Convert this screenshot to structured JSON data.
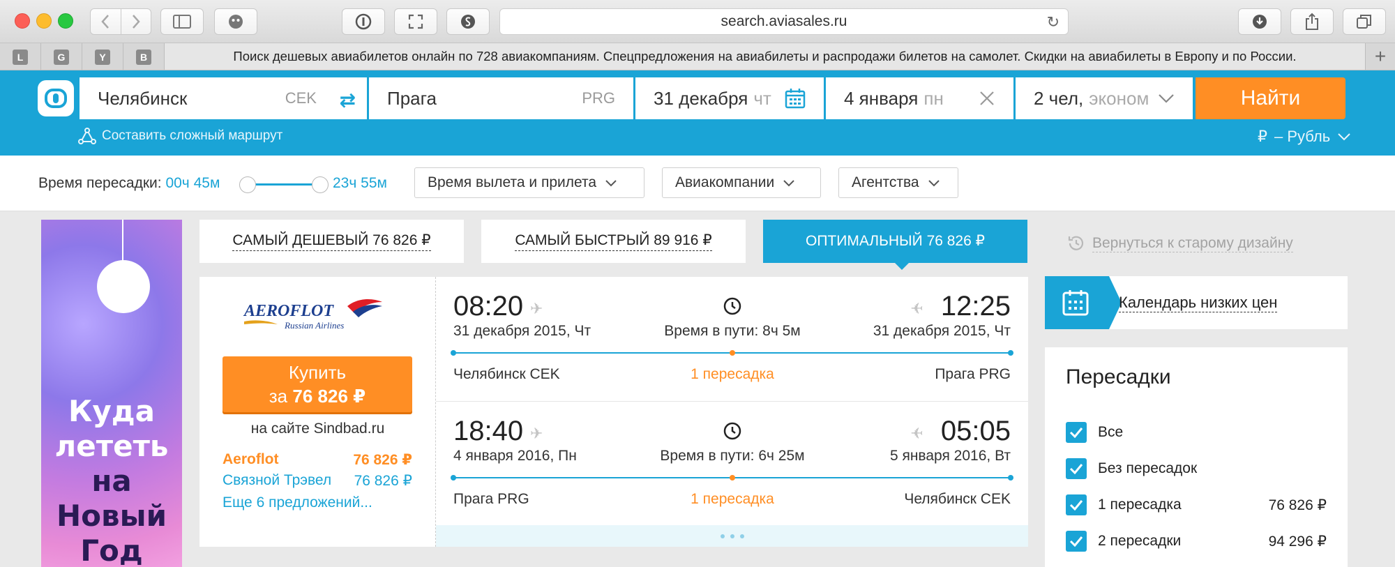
{
  "browser": {
    "url": "search.aviasales.ru",
    "bookmark_tabs": [
      "L",
      "G",
      "Y",
      "B"
    ],
    "tab_title": "Поиск дешевых авиабилетов онлайн по 728 авиакомпаниям. Спецпредложения на авиабилеты и распродажи билетов на самолет. Скидки на авиабилеты в Европу и по России."
  },
  "search": {
    "origin_city": "Челябинск",
    "origin_code": "CEK",
    "destination_city": "Прага",
    "destination_code": "PRG",
    "depart_date": "31 декабря",
    "depart_weekday": "чт",
    "return_date": "4 января",
    "return_weekday": "пн",
    "passengers": "2 чел,",
    "cabin_class": "эконом",
    "find_label": "Найти",
    "complex_route": "Составить сложный маршрут",
    "currency_symbol": "₽",
    "currency_label": "– Рубль"
  },
  "filters": {
    "transfer_time_label": "Время пересадки:",
    "transfer_min": "00ч 45м",
    "transfer_max": "23ч 55м",
    "dropdowns": [
      "Время вылета и прилета",
      "Авиакомпании",
      "Агентства"
    ]
  },
  "banner": {
    "line1": "Куда",
    "line2": "лететь",
    "line3": "на",
    "line4": "Новый",
    "line5": "Год"
  },
  "sort_tabs": [
    {
      "label": "Самый дешевый",
      "price": "76 826 ₽"
    },
    {
      "label": "Самый быстрый",
      "price": "89 916 ₽"
    },
    {
      "label": "Оптимальный",
      "price": "76 826 ₽"
    }
  ],
  "old_design_link": "Вернуться к старому дизайну",
  "result": {
    "airline_logo_name": "AEROFLOT",
    "airline_logo_sub": "Russian Airlines",
    "buy_line1": "Купить",
    "buy_prefix": "за",
    "buy_price": "76 826 ₽",
    "on_site": "на сайте Sindbad.ru",
    "offers": [
      {
        "name": "Aeroflot",
        "price": "76 826 ₽"
      },
      {
        "name": "Связной Трэвел",
        "price": "76 826 ₽"
      }
    ],
    "more_offers": "Еще 6 предложений...",
    "legs": [
      {
        "depart_time": "08:20",
        "depart_date": "31 декабря 2015, Чт",
        "duration": "Время в пути: 8ч 5м",
        "arrive_time": "12:25",
        "arrive_date": "31 декабря 2015, Чт",
        "from": "Челябинск CEK",
        "transfers": "1 пересадка",
        "to": "Прага PRG"
      },
      {
        "depart_time": "18:40",
        "depart_date": "4 января 2016, Пн",
        "duration": "Время в пути: 6ч 25м",
        "arrive_time": "05:05",
        "arrive_date": "5 января 2016, Вт",
        "from": "Прага PRG",
        "transfers": "1 пересадка",
        "to": "Челябинск CEK"
      }
    ]
  },
  "calendar_link": "Календарь низких цен",
  "transfers_filter": {
    "title": "Пересадки",
    "options": [
      {
        "label": "Все",
        "price": ""
      },
      {
        "label": "Без пересадок",
        "price": ""
      },
      {
        "label": "1 пересадка",
        "price": "76 826 ₽"
      },
      {
        "label": "2 пересадки",
        "price": "94 296 ₽"
      }
    ]
  },
  "colors": {
    "brand_blue": "#1aa4d6",
    "accent_orange": "#ff8e24"
  }
}
